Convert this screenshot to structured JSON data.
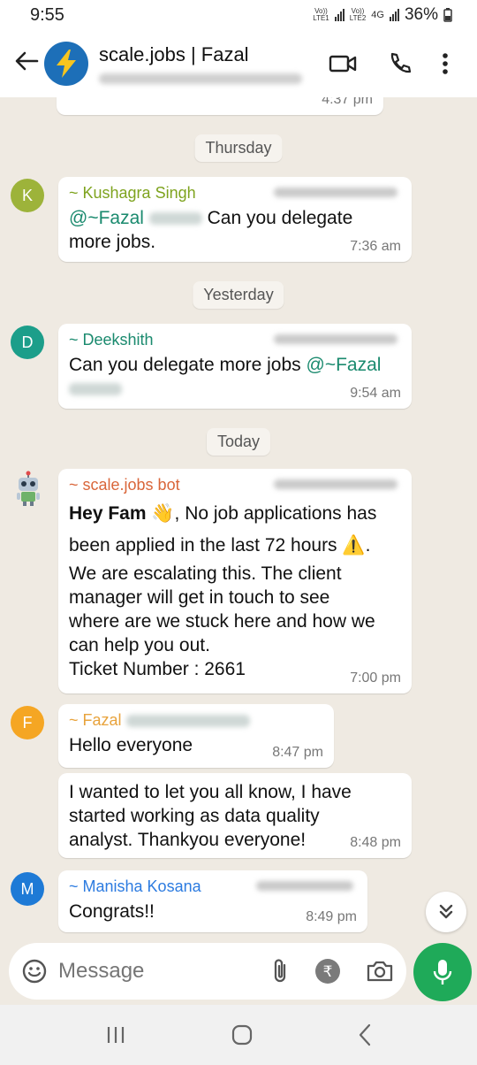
{
  "status_bar": {
    "time": "9:55",
    "net1_top": "Vo))",
    "net1_bottom": "LTE1",
    "net2_top": "Vo))",
    "net2_bottom": "LTE2",
    "net_type": "4G",
    "battery": "36%"
  },
  "header": {
    "title": "scale.jobs | Fazal"
  },
  "messages": {
    "top_time": "4:37 pm",
    "day1": "Thursday",
    "m1": {
      "avatar_letter": "K",
      "sender": "~ Kushagra Singh",
      "mention": "@~Fazal",
      "text_a": "Can you delegate",
      "text_b": "more jobs.",
      "time": "7:36 am"
    },
    "day2": "Yesterday",
    "m2": {
      "avatar_letter": "D",
      "sender": "~ Deekshith",
      "text": "Can you delegate more jobs",
      "mention": "@~Fazal",
      "time": "9:54 am"
    },
    "day3": "Today",
    "m3": {
      "sender": "~ scale.jobs bot",
      "bold": "Hey Fam",
      "emoji1": "👋",
      "line1": ", No job applications has",
      "line2": "been applied in the last 72 hours",
      "emoji2": "⚠️",
      "line2_end": ".",
      "line3": "We are escalating this. The client",
      "line4": "manager will get in touch to see",
      "line5": "where are we stuck here and how we",
      "line6": "can help you out.",
      "line7": "Ticket Number : 2661",
      "time": "7:00 pm"
    },
    "m4": {
      "avatar_letter": "F",
      "sender": "~ Fazal",
      "text": "Hello everyone",
      "time": "8:47 pm"
    },
    "m5": {
      "line1": "I wanted to let you all know, I have",
      "line2": "started working as data quality",
      "line3": "analyst. Thankyou everyone!",
      "time": "8:48 pm"
    },
    "m6": {
      "avatar_letter": "M",
      "sender": "~ Manisha Kosana",
      "text": "Congrats!!",
      "time": "8:49 pm"
    }
  },
  "composer": {
    "placeholder": "Message"
  },
  "colors": {
    "k_avatar": "#9db33a",
    "d_avatar": "#1c9e8a",
    "f_avatar": "#f5a623",
    "m_avatar": "#1e7ad6",
    "kushagra": "#7ea31e",
    "deekshith": "#1a8a6e",
    "bot": "#d9663a",
    "fazal": "#e8a33c",
    "manisha": "#2c7be0",
    "accent_green": "#1faa59"
  }
}
